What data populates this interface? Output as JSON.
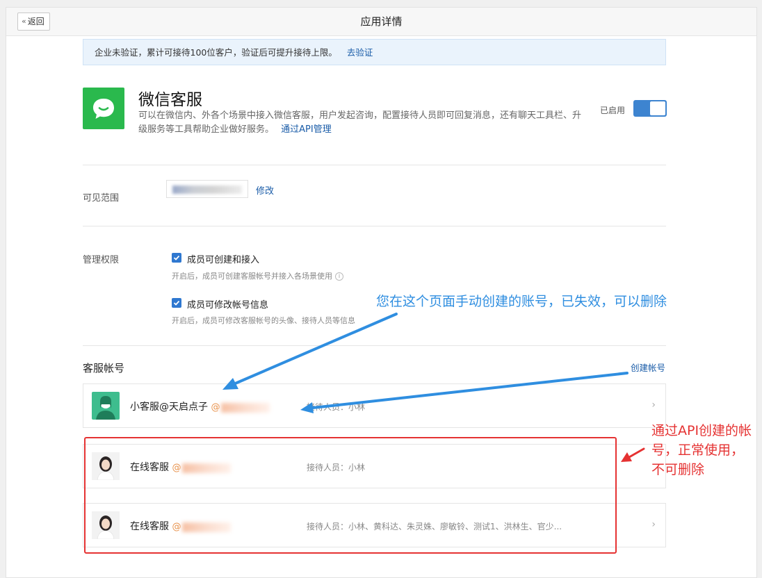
{
  "header": {
    "back_label": "返回",
    "title": "应用详情"
  },
  "notice": {
    "text": "企业未验证，累计可接待100位客户，验证后可提升接待上限。",
    "link": "去验证"
  },
  "app": {
    "name": "微信客服",
    "description": "可以在微信内、外各个场景中接入微信客服，用户发起咨询，配置接待人员即可回复消息，还有聊天工具栏、升级服务等工具帮助企业做好服务。",
    "api_link": "通过API管理",
    "status_label": "已启用",
    "enabled": true,
    "icon": "chat-bubble-icon",
    "icon_color": "#2ab94d"
  },
  "visibility": {
    "label": "可见范围",
    "edit_label": "修改"
  },
  "permissions": {
    "label": "管理权限",
    "items": [
      {
        "label": "成员可创建和接入",
        "hint": "开启后，成员可创建客服帐号并接入各场景使用",
        "checked": true
      },
      {
        "label": "成员可修改帐号信息",
        "hint": "开启后，成员可修改客服帐号的头像、接待人员等信息",
        "checked": true
      }
    ]
  },
  "accounts": {
    "title": "客服帐号",
    "create_label": "创建帐号",
    "list": [
      {
        "name": "小客服@天启点子",
        "id_prefix": "@",
        "staff": "接待人员：小林",
        "avatar": "default-user-icon"
      },
      {
        "name": "在线客服",
        "id_prefix": "@",
        "staff": "接待人员：小林",
        "avatar": "woman-photo-avatar"
      },
      {
        "name": "在线客服",
        "id_prefix": "@",
        "staff": "接待人员：小林、黄科达、朱灵姝、廖敏铃、测试1、洪林生、官少...",
        "avatar": "woman-photo-avatar"
      }
    ]
  },
  "annotations": {
    "blue": "您在这个页面手动创建的账号，已失效，可以删除",
    "red": "通过API创建的帐号，正常使用，不可删除",
    "blue_color": "#2f8ee0",
    "red_color": "#e53232"
  }
}
